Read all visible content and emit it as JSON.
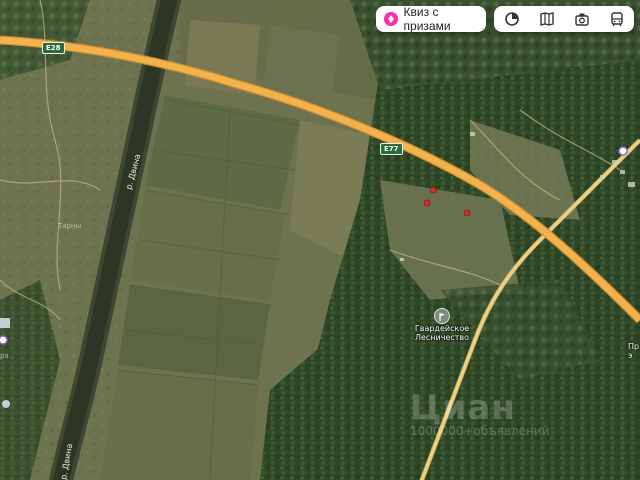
{
  "toolbar": {
    "quiz_label": "Квиз с призами",
    "buttons": [
      {
        "icon": "circle-layer-icon"
      },
      {
        "icon": "map-book-icon"
      },
      {
        "icon": "camera-icon"
      },
      {
        "icon": "bus-icon"
      }
    ]
  },
  "map": {
    "river_labels": [
      "р. Двина",
      "р. Двина"
    ],
    "roads": [
      {
        "shield": "E28"
      },
      {
        "shield": "E77"
      }
    ],
    "poi": {
      "name_line1": "Гвардейское",
      "name_line2": "Лесничество",
      "icon": "flag-icon"
    },
    "faint_labels": [
      "Тарны"
    ],
    "edge_label_right": "Пр\nэ",
    "edge_label_left": "ра",
    "markers_count_shown": 3,
    "watermark_line1": "Циан",
    "watermark_line2": "1000000+объявлений"
  },
  "colors": {
    "road": "#f2b24e",
    "road_edge": "#d58f2b",
    "marker": "#e02a2a",
    "river": "#3b4231",
    "forest": "#2f4a26",
    "field": "#6b7049"
  }
}
